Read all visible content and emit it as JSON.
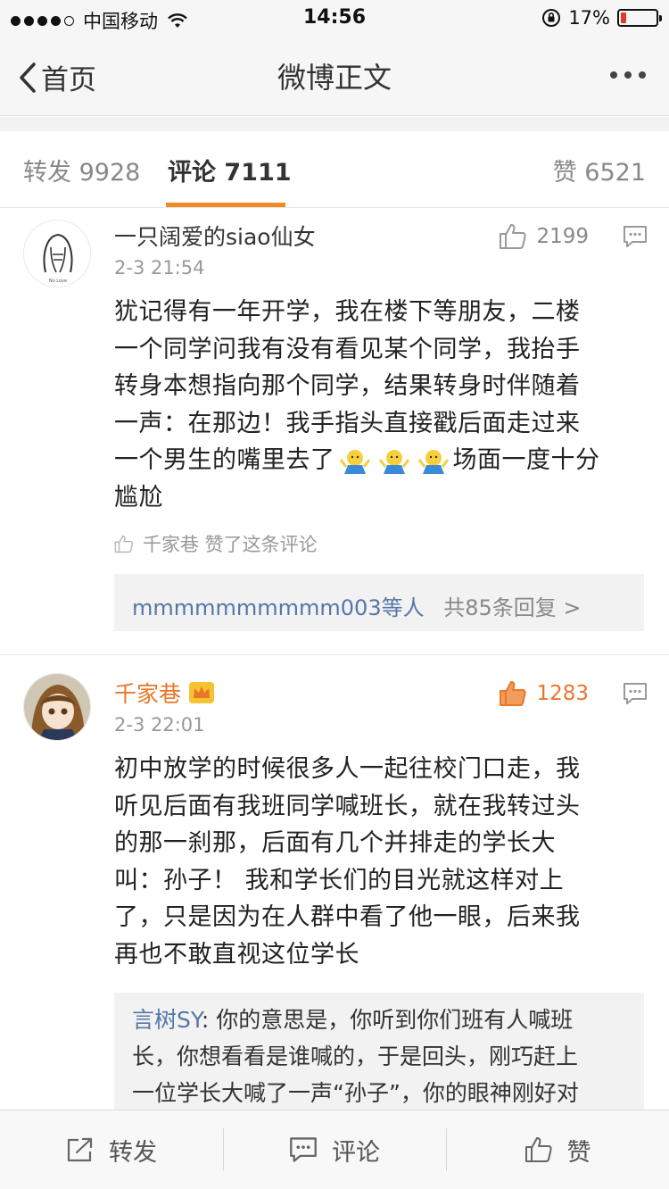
{
  "status_bar": {
    "carrier": "中国移动",
    "time": "14:56",
    "battery_text": "17%",
    "battery_level": 0.17,
    "battery_color": "#e03b2a"
  },
  "nav": {
    "back_label": "首页",
    "title": "微博正文",
    "more_icon": "more-dots-icon"
  },
  "tabs": {
    "repost_label": "转发 9928",
    "comment_label": "评论 7111",
    "like_label": "赞 6521",
    "active_color": "#f08a24"
  },
  "comments": [
    {
      "username": "一只阔爱的siao仙女",
      "avatar_caption": "No Love",
      "time": "2-3 21:54",
      "likes": "2199",
      "body_lines": [
        "犹记得有一年开学，我在楼下等朋友，二楼",
        "一个同学问我有没有看见某个同学，我抬手",
        "转身本想指向那个同学，结果转身时伴随着",
        "一声：在那边！我手指头直接戳后面走过来",
        "一个男生的嘴里去了",
        "场面一度十分",
        "尴尬"
      ],
      "liked_by": "千家巷 赞了这条评论",
      "reply_users": "mmmmmmmmmm003等人",
      "reply_count": "共85条回复 >"
    },
    {
      "username": "千家巷",
      "time": "2-3 22:01",
      "likes": "1283",
      "body_lines": [
        "初中放学的时候很多人一起往校门口走，我",
        "听见后面有我班同学喊班长，就在我转过头",
        "的那一刹那，后面有几个并排走的学长大",
        "叫：孙子！ 我和学长们的目光就这样对上",
        "了，只是因为在人群中看了他一眼，后来我",
        "再也不敢直视这位学长"
      ],
      "sub_reply": {
        "name": "言树SY",
        "lines": [
          ": 你的意思是，你听到你们班有人喊班",
          "长，你想看看是谁喊的，于是回头，刚巧赶上",
          "一位学长大喊了一声“孙子”，你的眼神刚好对"
        ]
      }
    }
  ],
  "toolbar": {
    "repost_label": "转发",
    "comment_label": "评论",
    "like_label": "赞"
  }
}
